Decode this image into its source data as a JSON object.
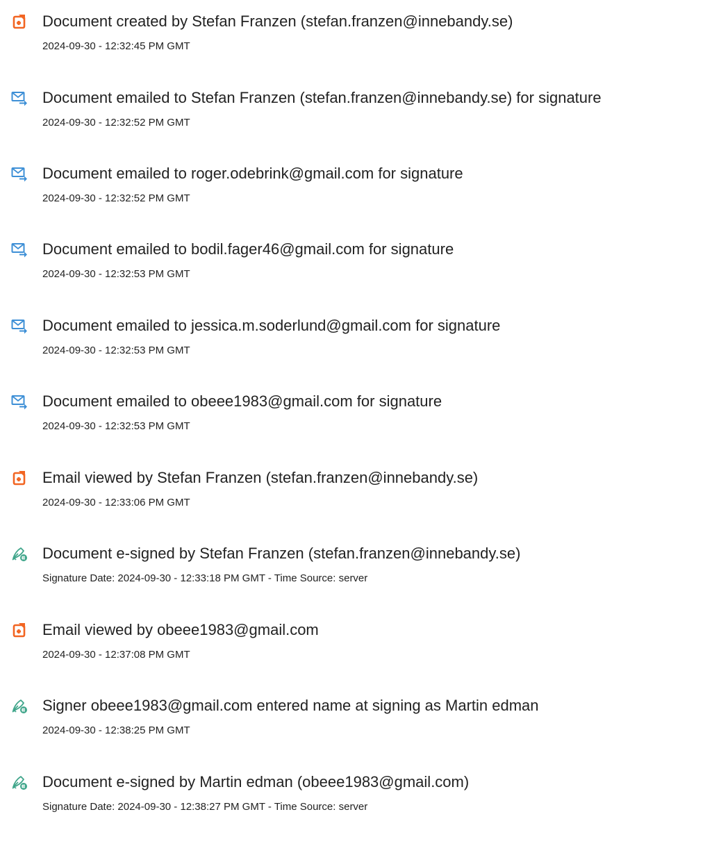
{
  "colors": {
    "doc_icon": "#f26522",
    "email_icon": "#3d8fd6",
    "sign_icon": "#3fa58a"
  },
  "events": [
    {
      "icon": "document-icon",
      "text": "Document created by Stefan Franzen (stefan.franzen@innebandy.se)",
      "time": "2024-09-30 - 12:32:45 PM GMT"
    },
    {
      "icon": "email-sent-icon",
      "text": "Document emailed to Stefan Franzen (stefan.franzen@innebandy.se) for signature",
      "time": "2024-09-30 - 12:32:52 PM GMT"
    },
    {
      "icon": "email-sent-icon",
      "text": "Document emailed to roger.odebrink@gmail.com for signature",
      "time": "2024-09-30 - 12:32:52 PM GMT"
    },
    {
      "icon": "email-sent-icon",
      "text": "Document emailed to bodil.fager46@gmail.com for signature",
      "time": "2024-09-30 - 12:32:53 PM GMT"
    },
    {
      "icon": "email-sent-icon",
      "text": "Document emailed to jessica.m.soderlund@gmail.com for signature",
      "time": "2024-09-30 - 12:32:53 PM GMT"
    },
    {
      "icon": "email-sent-icon",
      "text": "Document emailed to obeee1983@gmail.com for signature",
      "time": "2024-09-30 - 12:32:53 PM GMT"
    },
    {
      "icon": "document-icon",
      "text": "Email viewed by Stefan Franzen (stefan.franzen@innebandy.se)",
      "time": "2024-09-30 - 12:33:06 PM GMT"
    },
    {
      "icon": "e-sign-icon",
      "text": "Document e-signed by Stefan Franzen (stefan.franzen@innebandy.se)",
      "time": "Signature Date: 2024-09-30 - 12:33:18 PM GMT - Time Source: server"
    },
    {
      "icon": "document-icon",
      "text": "Email viewed by obeee1983@gmail.com",
      "time": "2024-09-30 - 12:37:08 PM GMT"
    },
    {
      "icon": "e-sign-icon",
      "text": "Signer obeee1983@gmail.com entered name at signing as Martin edman",
      "time": "2024-09-30 - 12:38:25 PM GMT"
    },
    {
      "icon": "e-sign-icon",
      "text": "Document e-signed by Martin edman (obeee1983@gmail.com)",
      "time": "Signature Date: 2024-09-30 - 12:38:27 PM GMT - Time Source: server"
    }
  ]
}
